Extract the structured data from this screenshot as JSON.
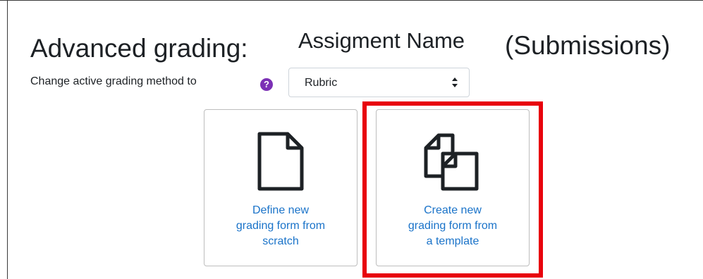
{
  "header": {
    "title": "Advanced grading:",
    "assignment_name": "Assigment Name",
    "area": "(Submissions)"
  },
  "method": {
    "label": "Change active grading method to",
    "help_icon": "question-circle-icon",
    "selected": "Rubric",
    "arrow_icon": "up-down-caret-icon"
  },
  "options": [
    {
      "icon": "blank-page-icon",
      "label_lines": [
        "Define new",
        "grading form from",
        "scratch"
      ]
    },
    {
      "icon": "copy-pages-icon",
      "label_lines": [
        "Create new",
        "grading form from",
        "a template"
      ]
    }
  ],
  "colors": {
    "link": "#1a73c9",
    "help_icon_bg": "#7b2fb5",
    "highlight": "#e8000b"
  }
}
